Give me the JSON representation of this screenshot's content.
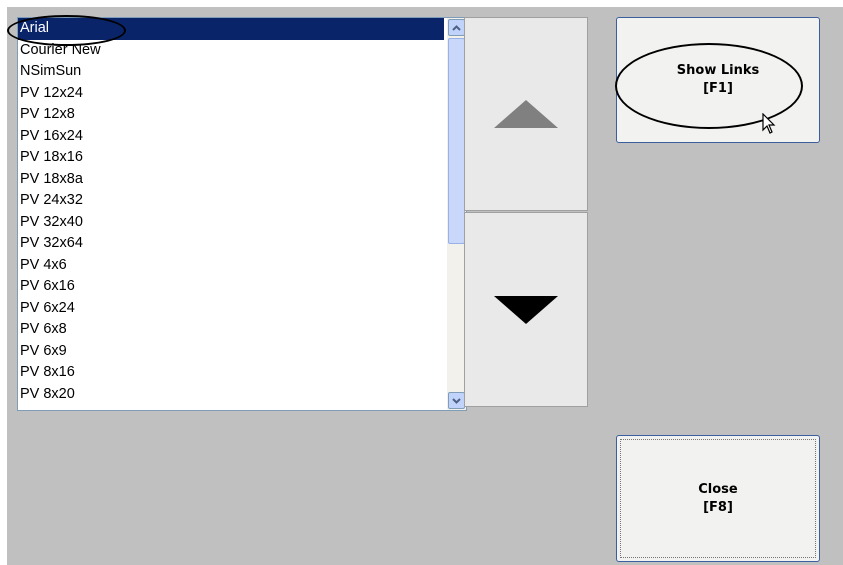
{
  "font_list": {
    "items": [
      "Arial",
      "Courier New",
      "NSimSun",
      "PV 12x24",
      "PV 12x8",
      "PV 16x24",
      "PV 18x16",
      "PV 18x8a",
      "PV 24x32",
      "PV 32x40",
      "PV 32x64",
      "PV 4x6",
      "PV 6x16",
      "PV 6x24",
      "PV 6x8",
      "PV 6x9",
      "PV 8x16",
      "PV 8x20"
    ],
    "selected_index": 0
  },
  "buttons": {
    "show_links": {
      "line1": "Show Links",
      "line2": "[F1]"
    },
    "close": {
      "line1": "Close",
      "line2": "[F8]"
    }
  },
  "icons": {
    "scroll_up": "chevron-up-icon",
    "scroll_down": "chevron-down-icon",
    "page_up": "triangle-up-icon",
    "page_down": "triangle-down-icon",
    "cursor": "mouse-pointer-icon"
  },
  "colors": {
    "panel_bg": "#c0c0c0",
    "selection_bg": "#0a246a",
    "button_border": "#3a5ea0"
  }
}
